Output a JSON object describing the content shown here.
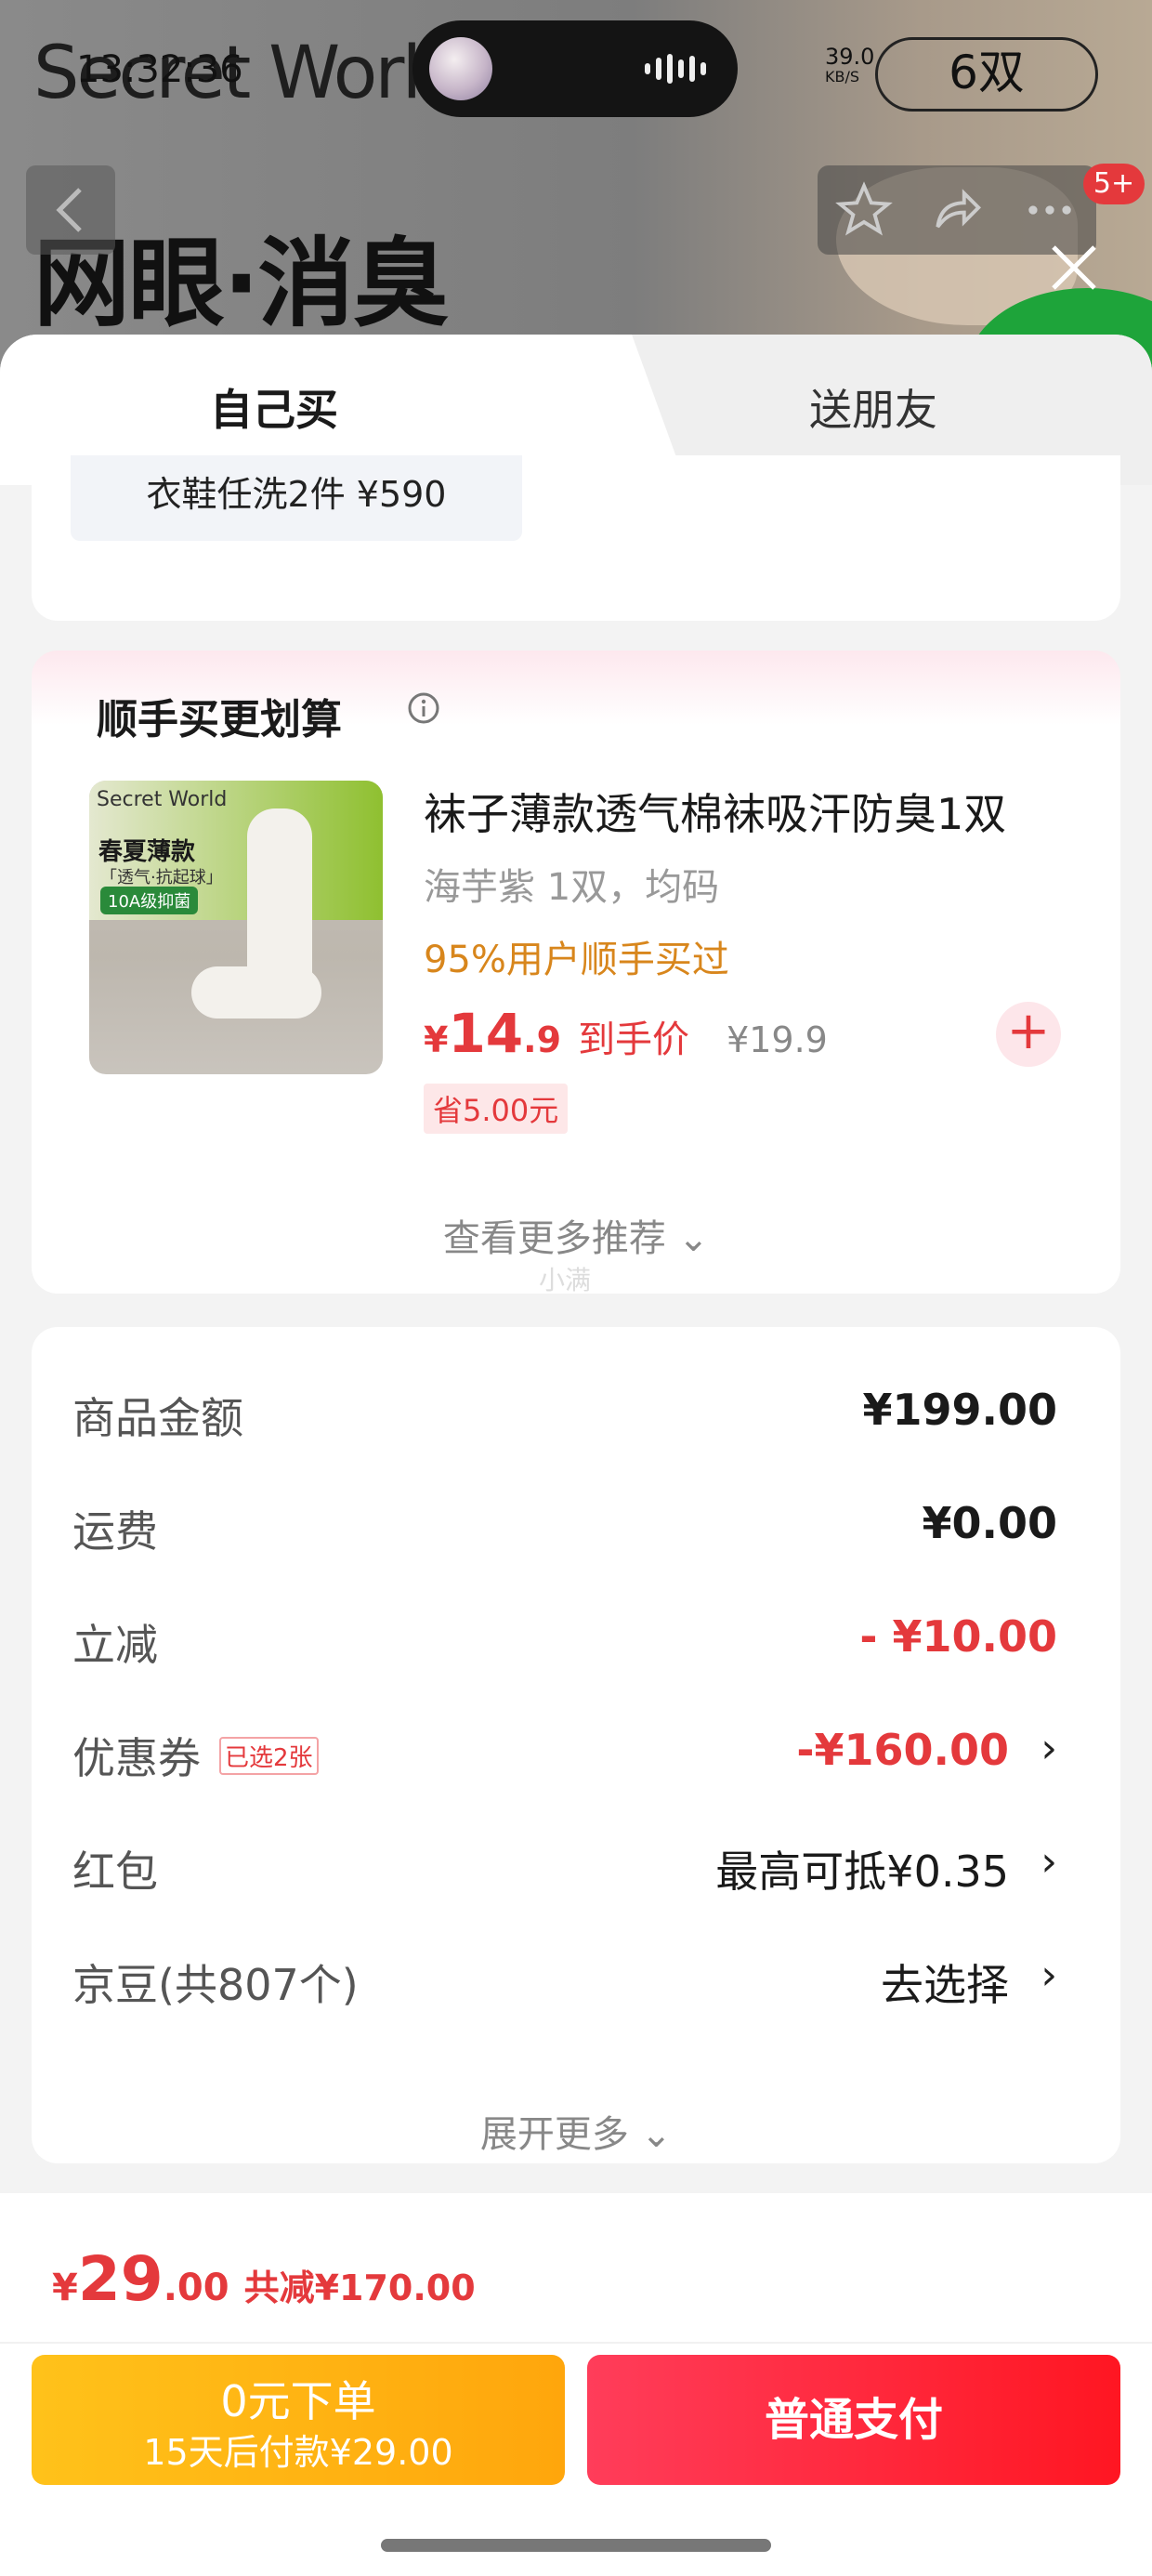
{
  "background": {
    "brand": "Secret World",
    "promo": "网眼·消臭",
    "badge": "5+"
  },
  "status_bar": {
    "time": "13:32:36",
    "speed_value": "39.0",
    "speed_unit": "KB/S",
    "battery": "6双"
  },
  "tabs": {
    "self": "自己买",
    "friend": "送朋友"
  },
  "promo_pill": "衣鞋任洗2件 ¥590",
  "addon": {
    "title": "顺手买更划算",
    "image_labels": {
      "brand": "Secret World",
      "headline": "春夏薄款",
      "sub": "「透气·抗起球」",
      "grade": "10A级抑菌"
    },
    "product_name": "袜子薄款透气棉袜吸汗防臭1双",
    "spec": "海芋紫 1双，均码",
    "hint": "95%用户顺手买过",
    "price_currency": "¥",
    "price_int": "14",
    "price_dec": ".9",
    "price_tag": "到手价",
    "orig_price": "¥19.9",
    "save": "省5.00元",
    "more": "查看更多推荐",
    "watermark": "小满"
  },
  "summary": {
    "rows": [
      {
        "key": "商品金额",
        "value": "¥199.00"
      },
      {
        "key": "运费",
        "value": "¥0.00"
      },
      {
        "key": "立减",
        "value": "- ¥10.00"
      },
      {
        "key": "优惠券",
        "tag": "已选2张",
        "value": "-¥160.00"
      },
      {
        "key": "红包",
        "value": "最高可抵¥0.35"
      },
      {
        "key": "京豆(共807个)",
        "value": "去选择"
      }
    ],
    "expand": "展开更多"
  },
  "footer": {
    "total_currency": "¥",
    "total_int": "29",
    "total_dec": ".00",
    "total_saved": "共减¥170.00",
    "pay_later_line1": "0元下单",
    "pay_later_line2": "15天后付款¥29.00",
    "pay_now": "普通支付"
  },
  "colors": {
    "accent_red": "#e4393c",
    "hint_orange": "#d8861c",
    "pay_later_yellow": "#ffb412",
    "pay_now_red": "#ff2a3e"
  },
  "icons": [
    "back-icon",
    "star-icon",
    "share-icon",
    "more-icon",
    "close-icon",
    "info-icon",
    "plus-icon",
    "chevron-down-icon",
    "chevron-right-icon"
  ]
}
